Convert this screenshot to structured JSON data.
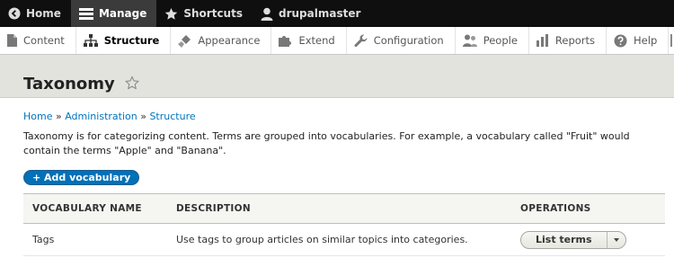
{
  "toolbar": {
    "items": [
      {
        "label": "Home",
        "icon": "home-back-icon"
      },
      {
        "label": "Manage",
        "icon": "hamburger-menu-icon"
      },
      {
        "label": "Shortcuts",
        "icon": "star-icon"
      },
      {
        "label": "drupalmaster",
        "icon": "user-icon"
      }
    ]
  },
  "tray": {
    "items": [
      {
        "label": "Content",
        "icon": "file-icon"
      },
      {
        "label": "Structure",
        "icon": "sitemap-icon"
      },
      {
        "label": "Appearance",
        "icon": "paintbrush-icon"
      },
      {
        "label": "Extend",
        "icon": "puzzle-icon"
      },
      {
        "label": "Configuration",
        "icon": "wrench-icon"
      },
      {
        "label": "People",
        "icon": "people-icon"
      },
      {
        "label": "Reports",
        "icon": "bar-chart-icon"
      },
      {
        "label": "Help",
        "icon": "help-icon"
      }
    ]
  },
  "page": {
    "title": "Taxonomy"
  },
  "breadcrumb": {
    "items": [
      "Home",
      "Administration",
      "Structure"
    ],
    "separator": "»"
  },
  "help_text": "Taxonomy is for categorizing content. Terms are grouped into vocabularies. For example, a vocabulary called \"Fruit\" would contain the terms \"Apple\" and \"Banana\".",
  "add_button": "+ Add vocabulary",
  "table": {
    "headers": [
      "VOCABULARY NAME",
      "DESCRIPTION",
      "OPERATIONS"
    ],
    "rows": [
      {
        "name": "Tags",
        "description": "Use tags to group articles on similar topics into categories.",
        "operation": "List terms"
      }
    ]
  },
  "colors": {
    "toolbar_bg": "#0f0f0f",
    "link": "#0074bd",
    "primary_button": "#0071b8",
    "header_bg": "#e3e3de"
  }
}
